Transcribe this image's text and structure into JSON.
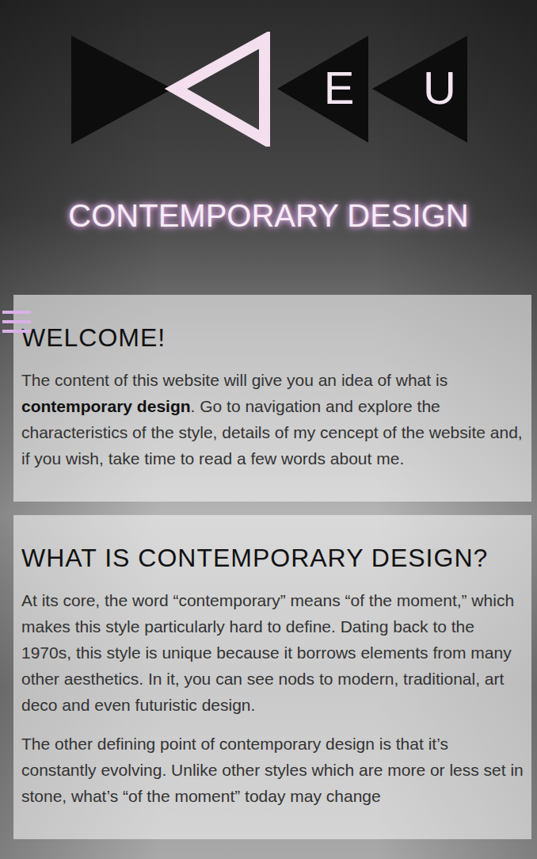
{
  "header": {
    "logo_letters": [
      "E",
      "U"
    ],
    "title": "CONTEMPORARY DESIGN"
  },
  "sections": [
    {
      "heading": "WELCOME!",
      "paragraphs": [
        [
          {
            "text": "The content of this website will give you an idea of what is ",
            "bold": false
          },
          {
            "text": "contemporary design",
            "bold": true
          },
          {
            "text": ". Go to navigation and explore the characteristics of the style, details of my cencept of the website and, if you wish, take time to read a few words about me.",
            "bold": false
          }
        ]
      ]
    },
    {
      "heading": "WHAT IS CONTEMPORARY DESIGN?",
      "paragraphs": [
        [
          {
            "text": "At its core, the word “contemporary” means “of the moment,” which makes this style particularly hard to define. Dating back to the 1970s, this style is unique because it borrows elements from many other aesthetics. In it, you can see nods to modern, traditional, art deco and even futuristic design.",
            "bold": false
          }
        ],
        [
          {
            "text": "The other defining point of contemporary design is that it’s constantly evolving. Unlike other styles which are more or less set in stone, what’s “of the moment” today may change",
            "bold": false
          }
        ]
      ]
    }
  ]
}
